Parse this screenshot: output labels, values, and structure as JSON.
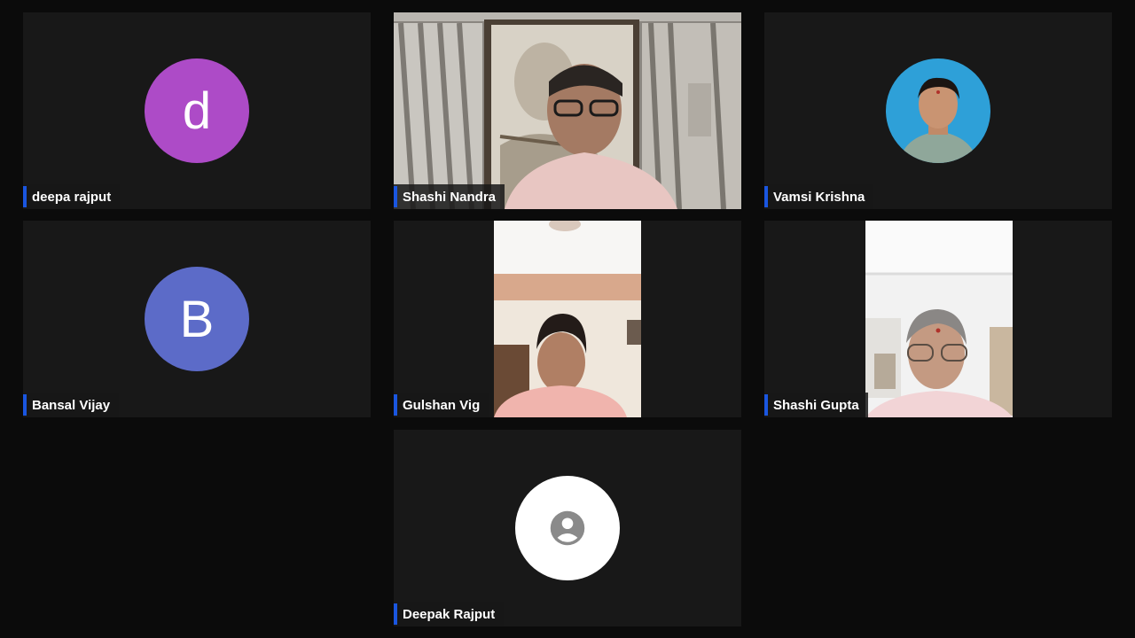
{
  "participants": [
    {
      "name": "deepa rajput",
      "initial": "d",
      "color": "#ad4bc7"
    },
    {
      "name": "Shashi Nandra"
    },
    {
      "name": "Vamsi Krishna"
    },
    {
      "name": "Bansal Vijay",
      "initial": "B",
      "color": "#5c6bc8"
    },
    {
      "name": "Gulshan Vig"
    },
    {
      "name": "Shashi Gupta"
    },
    {
      "name": "Deepak Rajput",
      "icon": "account-circle-icon"
    }
  ]
}
